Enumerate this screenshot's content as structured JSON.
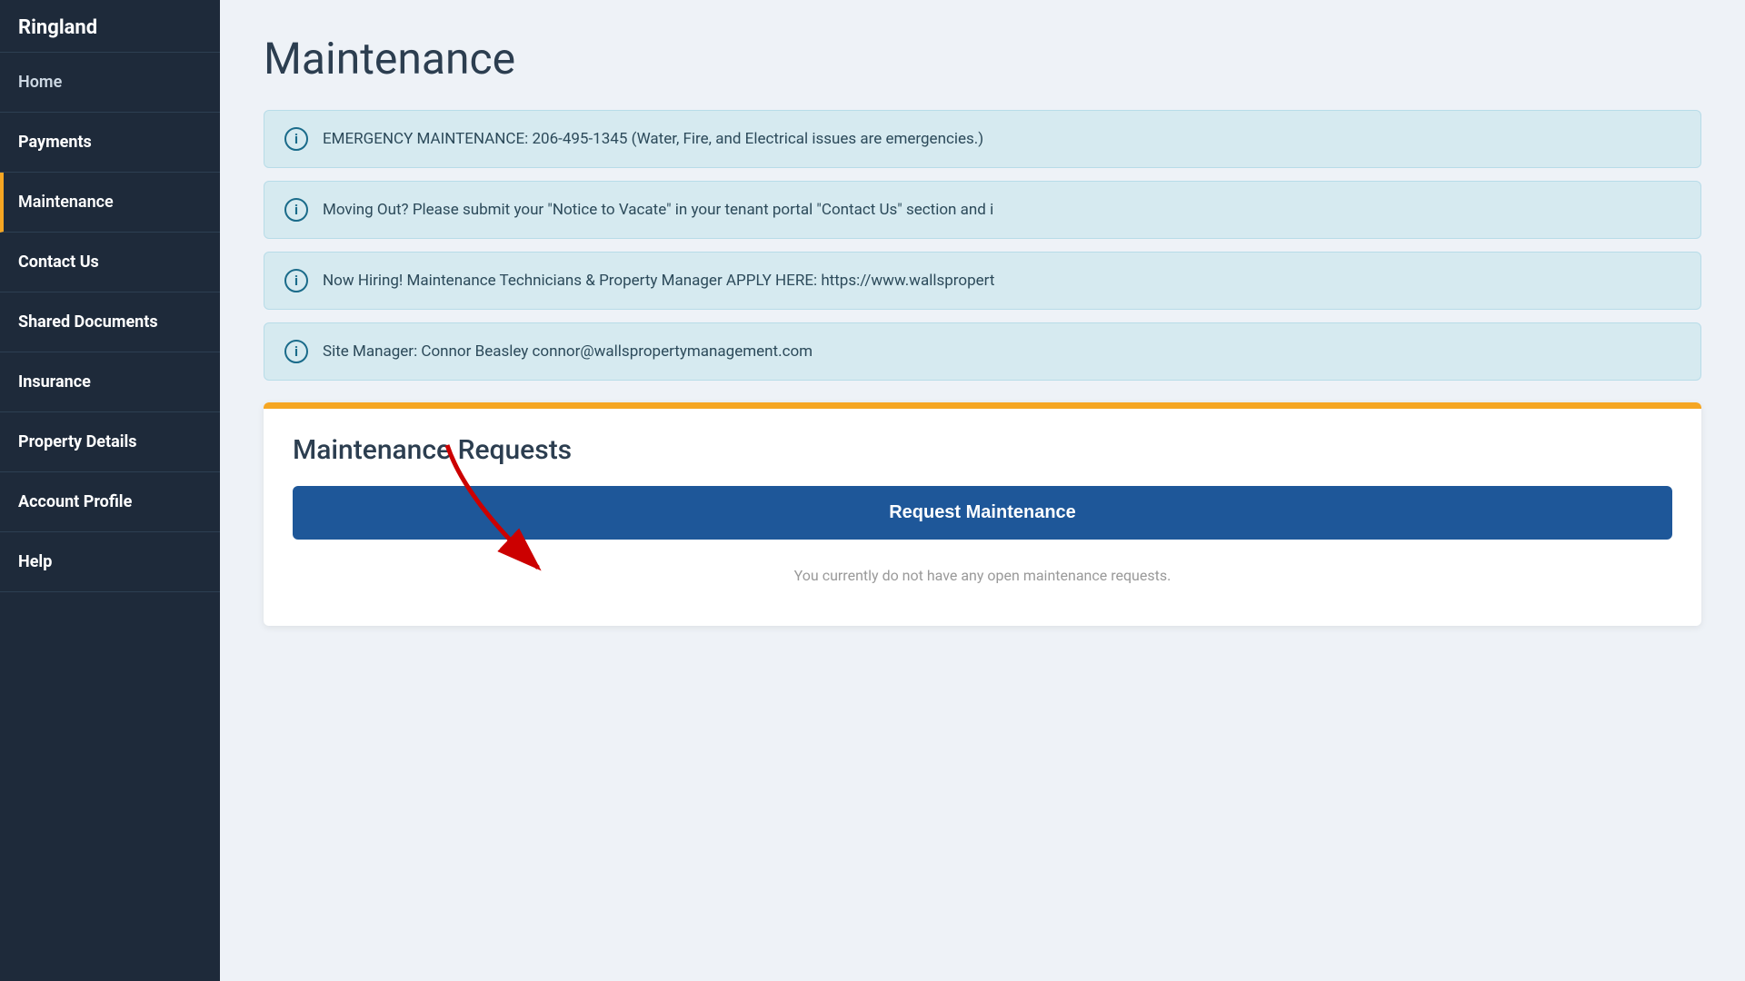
{
  "sidebar": {
    "logo": "Ringland",
    "items": [
      {
        "id": "home",
        "label": "Home",
        "active": false
      },
      {
        "id": "payments",
        "label": "Payments",
        "active": false,
        "bold": true
      },
      {
        "id": "maintenance",
        "label": "Maintenance",
        "active": true
      },
      {
        "id": "contact-us",
        "label": "Contact Us",
        "active": false,
        "bold": true
      },
      {
        "id": "shared-documents",
        "label": "Shared Documents",
        "active": false,
        "bold": true
      },
      {
        "id": "insurance",
        "label": "Insurance",
        "active": false,
        "bold": true
      },
      {
        "id": "property-details",
        "label": "Property Details",
        "active": false,
        "bold": true
      },
      {
        "id": "account-profile",
        "label": "Account Profile",
        "active": false,
        "bold": true
      },
      {
        "id": "help",
        "label": "Help",
        "active": false,
        "bold": true
      }
    ]
  },
  "main": {
    "page_title": "Maintenance",
    "info_banners": [
      {
        "id": "emergency",
        "text": "EMERGENCY MAINTENANCE: 206-495-1345 (Water, Fire, and Electrical issues are emergencies.)"
      },
      {
        "id": "moving-out",
        "text": "Moving Out? Please submit your \"Notice to Vacate\" in your tenant portal \"Contact Us\" section and i"
      },
      {
        "id": "hiring",
        "text": "Now Hiring! Maintenance Technicians & Property Manager APPLY HERE: https://www.wallspropert"
      },
      {
        "id": "site-manager",
        "text": "Site Manager: Connor Beasley connor@wallspropertymanagement.com"
      }
    ],
    "maintenance_requests": {
      "section_title": "Maintenance Requests",
      "request_button_label": "Request Maintenance",
      "empty_state_text": "You currently do not have any open maintenance requests."
    }
  }
}
